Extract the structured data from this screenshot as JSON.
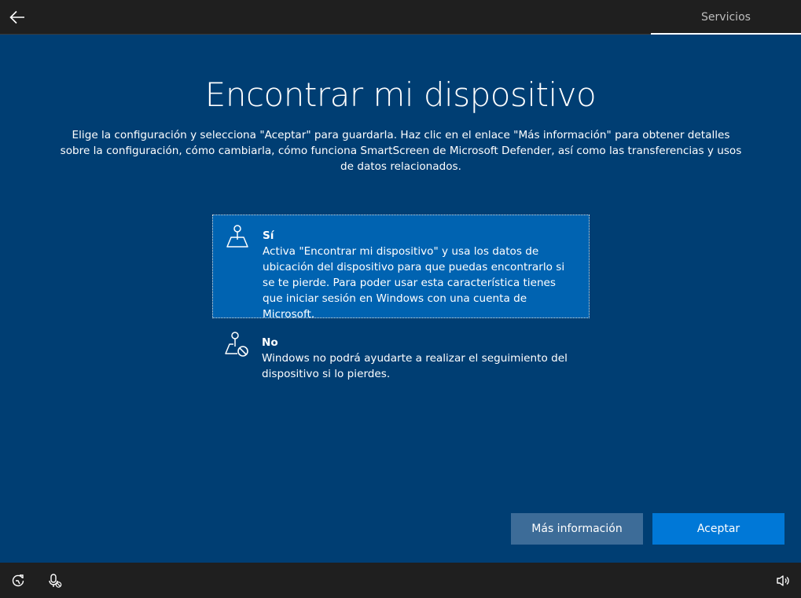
{
  "header": {
    "back_label": "",
    "tab_label": "Servicios"
  },
  "main": {
    "title": "Encontrar mi dispositivo",
    "description": "Elige la configuración y selecciona \"Aceptar\" para guardarla. Haz clic en el enlace \"Más información\" para obtener detalles sobre la configuración, cómo cambiarla, cómo funciona SmartScreen de Microsoft Defender, así como las transferencias y usos de datos relacionados.",
    "options": [
      {
        "title": "Sí",
        "body": "Activa \"Encontrar mi dispositivo\" y usa los datos de ubicación del dispositivo para que puedas encontrarlo si se te pierde. Para poder usar esta característica tienes que iniciar sesión en Windows con una cuenta de Microsoft.",
        "icon": "map-pin-icon",
        "selected": true
      },
      {
        "title": "No",
        "body": "Windows no podrá ayudarte a realizar el seguimiento del dispositivo si lo pierdes.",
        "icon": "map-pin-blocked-icon",
        "selected": false
      }
    ]
  },
  "buttons": {
    "more_info": "Más información",
    "accept": "Aceptar"
  },
  "footer": {
    "icons": [
      "ease-of-access-icon",
      "microphone-off-icon",
      "volume-icon"
    ]
  },
  "colors": {
    "background": "#003e73",
    "selected_option": "#0063b1",
    "accent_button": "#0078d7",
    "secondary_button": "#3d6c98",
    "bar": "#1f1f1f"
  }
}
